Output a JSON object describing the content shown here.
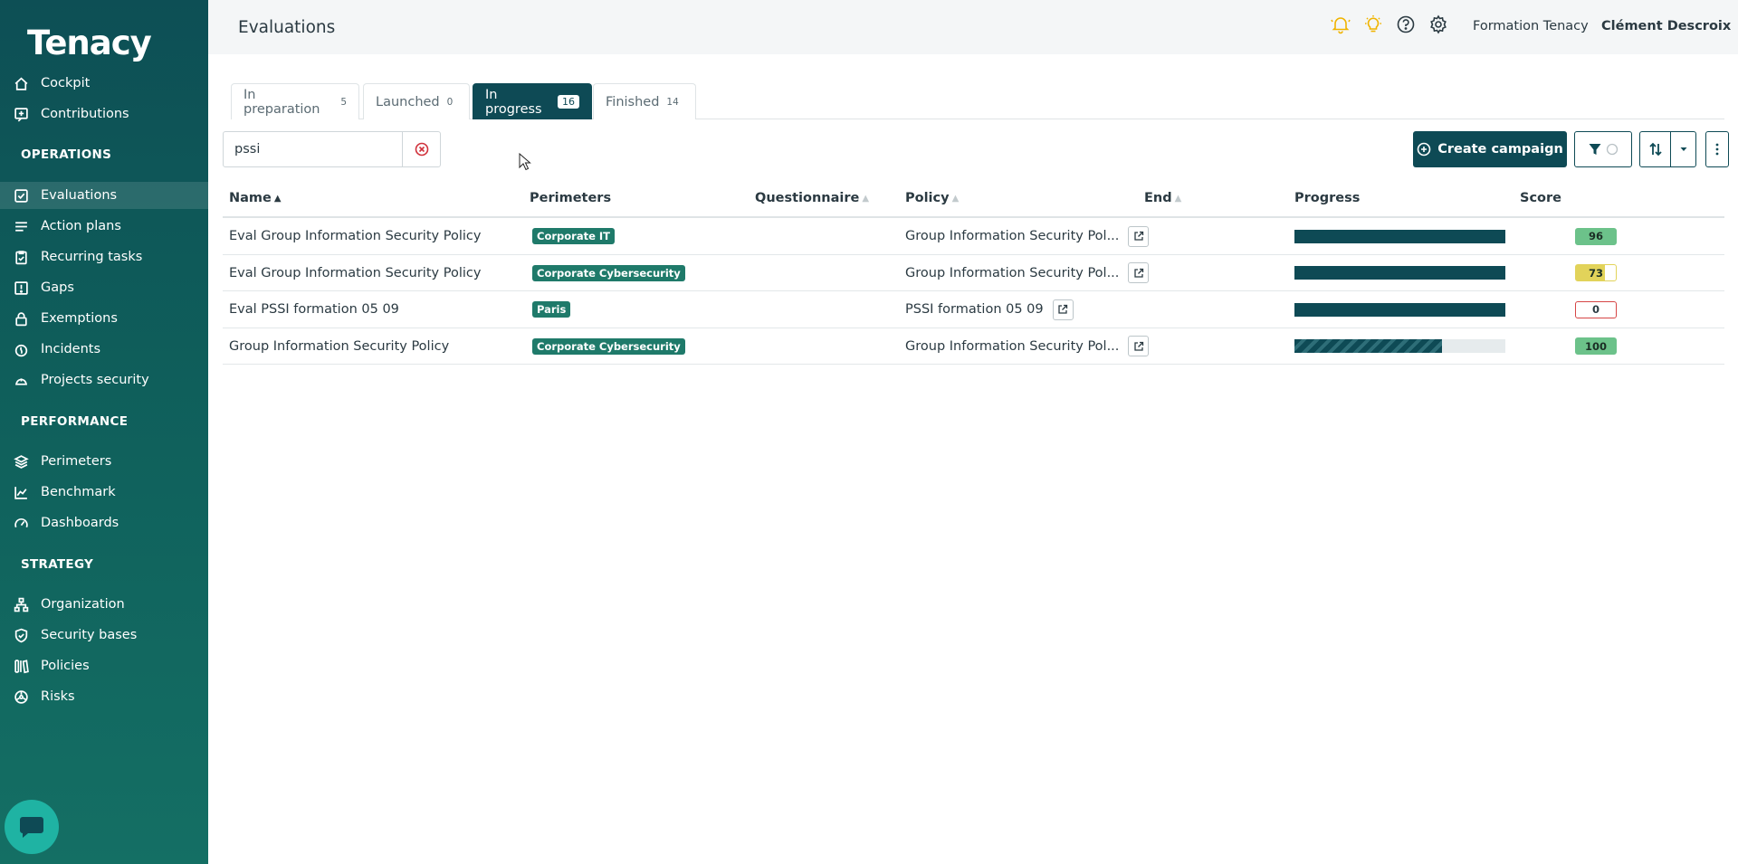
{
  "app": {
    "logo": "Tenacy",
    "page_title": "Evaluations"
  },
  "header": {
    "organization": "Formation Tenacy",
    "user": "Clément Descroix",
    "icons": [
      "bell-icon",
      "lightbulb-icon",
      "help-icon",
      "gear-icon"
    ]
  },
  "sidebar": {
    "top_items": [
      {
        "label": "Cockpit",
        "icon": "home-icon"
      },
      {
        "label": "Contributions",
        "icon": "contribution-icon"
      }
    ],
    "sections": [
      {
        "title": "OPERATIONS",
        "items": [
          {
            "label": "Evaluations",
            "icon": "checkbox-icon",
            "active": true
          },
          {
            "label": "Action plans",
            "icon": "list-icon"
          },
          {
            "label": "Recurring tasks",
            "icon": "clipboard-icon"
          },
          {
            "label": "Gaps",
            "icon": "alert-square-icon"
          },
          {
            "label": "Exemptions",
            "icon": "lock-icon"
          },
          {
            "label": "Incidents",
            "icon": "fire-icon"
          },
          {
            "label": "Projects security",
            "icon": "helmet-icon"
          }
        ]
      },
      {
        "title": "PERFORMANCE",
        "items": [
          {
            "label": "Perimeters",
            "icon": "layers-icon"
          },
          {
            "label": "Benchmark",
            "icon": "chart-line-icon"
          },
          {
            "label": "Dashboards",
            "icon": "gauge-icon"
          }
        ]
      },
      {
        "title": "STRATEGY",
        "items": [
          {
            "label": "Organization",
            "icon": "org-chart-icon"
          },
          {
            "label": "Security bases",
            "icon": "shield-check-icon"
          },
          {
            "label": "Policies",
            "icon": "books-icon"
          },
          {
            "label": "Risks",
            "icon": "biohazard-icon"
          }
        ]
      }
    ]
  },
  "tabs": [
    {
      "label": "In preparation",
      "count": "5"
    },
    {
      "label": "Launched",
      "count": "0"
    },
    {
      "label": "In progress",
      "count": "16",
      "active": true
    },
    {
      "label": "Finished",
      "count": "14"
    }
  ],
  "search": {
    "value": "pssi"
  },
  "toolbar": {
    "create_label": "Create campaign"
  },
  "table": {
    "columns": [
      "Name",
      "Perimeters",
      "Questionnaire",
      "Policy",
      "End",
      "Progress",
      "Score"
    ],
    "rows": [
      {
        "name": "Eval Group Information Security Policy",
        "perimeter": "Corporate IT",
        "questionnaire": "",
        "policy": "Group Information Security Pol...",
        "end": "",
        "progress": 1.0,
        "striped": false,
        "score": "96",
        "score_color": "#6cc28a",
        "score_fill": 1.0
      },
      {
        "name": "Eval Group Information Security Policy",
        "perimeter": "Corporate Cybersecurity",
        "questionnaire": "",
        "policy": "Group Information Security Pol...",
        "end": "",
        "progress": 1.0,
        "striped": false,
        "score": "73",
        "score_color": "#e2d35a",
        "score_fill": 0.73
      },
      {
        "name": "Eval PSSI formation 05 09",
        "perimeter": "Paris",
        "questionnaire": "",
        "policy": "PSSI formation 05 09",
        "end": "",
        "progress": 1.0,
        "striped": false,
        "score": "0",
        "score_color": "#d64545",
        "score_fill": 0.0
      },
      {
        "name": "Group Information Security Policy",
        "perimeter": "Corporate Cybersecurity",
        "questionnaire": "",
        "policy": "Group Information Security Pol...",
        "end": "",
        "progress": 0.7,
        "striped": true,
        "score": "100",
        "score_color": "#6cc28a",
        "score_fill": 1.0
      }
    ]
  }
}
